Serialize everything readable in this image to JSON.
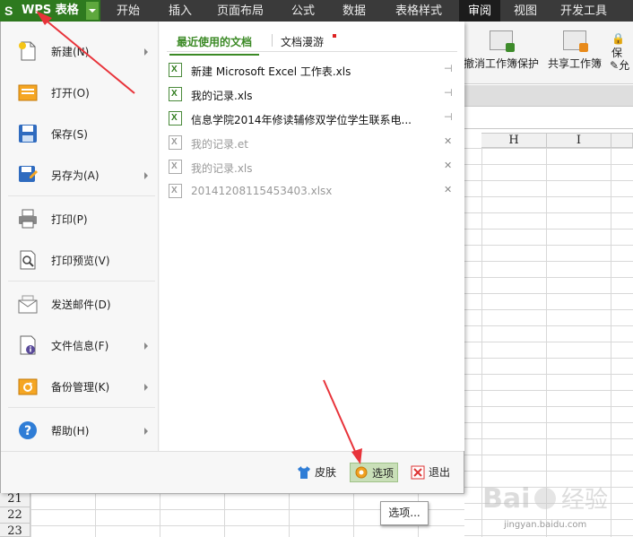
{
  "app": {
    "logo": "S",
    "title": "WPS 表格"
  },
  "menubar": {
    "tabs": [
      "开始",
      "插入",
      "页面布局",
      "公式",
      "数据",
      "表格样式",
      "审阅",
      "视图",
      "开发工具"
    ],
    "active_tab": "审阅"
  },
  "ribbon": {
    "undo_protect": "撤消工作簿保护",
    "share": "共享工作簿",
    "small1": "保",
    "small2": "允"
  },
  "columns": [
    "H",
    "I"
  ],
  "rows": [
    "21",
    "22",
    "23"
  ],
  "file_menu": {
    "items": [
      {
        "label": "新建(N)",
        "icon": "new-doc-icon",
        "submenu": true
      },
      {
        "label": "打开(O)",
        "icon": "open-folder-icon",
        "submenu": false
      },
      {
        "label": "保存(S)",
        "icon": "save-disk-icon",
        "submenu": false
      },
      {
        "label": "另存为(A)",
        "icon": "save-as-icon",
        "submenu": true
      },
      {
        "label": "打印(P)",
        "icon": "printer-icon",
        "submenu": false
      },
      {
        "label": "打印预览(V)",
        "icon": "print-preview-icon",
        "submenu": false
      },
      {
        "label": "发送邮件(D)",
        "icon": "mail-icon",
        "submenu": false
      },
      {
        "label": "文件信息(F)",
        "icon": "file-info-icon",
        "submenu": true
      },
      {
        "label": "备份管理(K)",
        "icon": "backup-icon",
        "submenu": true
      },
      {
        "label": "帮助(H)",
        "icon": "help-icon",
        "submenu": true
      }
    ],
    "tabs": {
      "recent": "最近使用的文档",
      "roaming": "文档漫游"
    },
    "recent_docs": [
      {
        "name": "新建 Microsoft Excel 工作表.xls",
        "dim": false,
        "action": "pin"
      },
      {
        "name": "我的记录.xls",
        "dim": false,
        "action": "pin"
      },
      {
        "name": "信息学院2014年修读辅修双学位学生联系电...",
        "dim": false,
        "action": "pin"
      },
      {
        "name": "我的记录.et",
        "dim": true,
        "action": "remove"
      },
      {
        "name": "我的记录.xls",
        "dim": true,
        "action": "remove"
      },
      {
        "name": "20141208115453403.xlsx",
        "dim": true,
        "action": "remove"
      }
    ],
    "footer": {
      "skin": "皮肤",
      "options": "选项",
      "exit": "退出"
    }
  },
  "tooltip": "选项...",
  "watermark": {
    "logo": "Bai 经验",
    "url": "jingyan.baidu.com"
  },
  "colors": {
    "accent": "#2e7a1f",
    "menubar": "#3a3a3a",
    "arrow": "#e8333a",
    "highlight": "#c9dfb8"
  }
}
